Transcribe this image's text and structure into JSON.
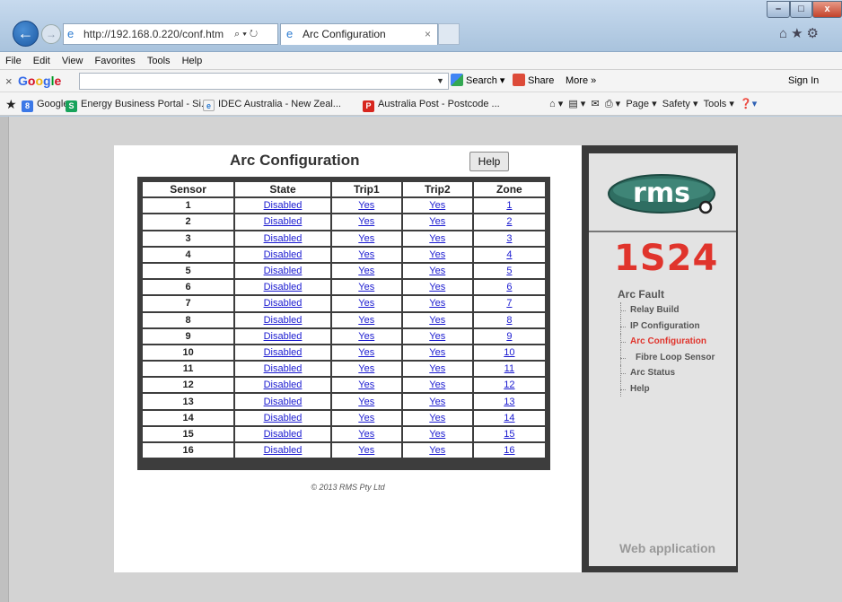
{
  "browser": {
    "window_controls": {
      "minimize": "–",
      "maximize": "□",
      "close": "x"
    },
    "address": "http://192.168.0.220/conf.htm",
    "address_host_bold": "192.168.0.220",
    "tab_title": "Arc Configuration",
    "menu": [
      "File",
      "Edit",
      "View",
      "Favorites",
      "Tools",
      "Help"
    ],
    "google_toolbar": {
      "logo": "Google",
      "search_label": "Search",
      "share_label": "Share",
      "more_label": "More »",
      "signin_label": "Sign In"
    },
    "favorites": [
      {
        "label": "Google",
        "icon": "google-bookmark-icon"
      },
      {
        "label": "Energy Business Portal - Si...",
        "icon": "energy-portal-icon"
      },
      {
        "label": "IDEC Australia - New Zeal...",
        "icon": "ie-page-icon"
      },
      {
        "label": "Australia Post - Postcode ...",
        "icon": "auspost-icon"
      }
    ],
    "command_bar": {
      "page": "Page ▾",
      "safety": "Safety ▾",
      "tools": "Tools ▾"
    }
  },
  "page": {
    "heading": "Arc Configuration",
    "help_button": "Help",
    "table": {
      "headers": [
        "Sensor",
        "State",
        "Trip1",
        "Trip2",
        "Zone"
      ],
      "rows": [
        [
          "1",
          "Disabled",
          "Yes",
          "Yes",
          "1"
        ],
        [
          "2",
          "Disabled",
          "Yes",
          "Yes",
          "2"
        ],
        [
          "3",
          "Disabled",
          "Yes",
          "Yes",
          "3"
        ],
        [
          "4",
          "Disabled",
          "Yes",
          "Yes",
          "4"
        ],
        [
          "5",
          "Disabled",
          "Yes",
          "Yes",
          "5"
        ],
        [
          "6",
          "Disabled",
          "Yes",
          "Yes",
          "6"
        ],
        [
          "7",
          "Disabled",
          "Yes",
          "Yes",
          "7"
        ],
        [
          "8",
          "Disabled",
          "Yes",
          "Yes",
          "8"
        ],
        [
          "9",
          "Disabled",
          "Yes",
          "Yes",
          "9"
        ],
        [
          "10",
          "Disabled",
          "Yes",
          "Yes",
          "10"
        ],
        [
          "11",
          "Disabled",
          "Yes",
          "Yes",
          "11"
        ],
        [
          "12",
          "Disabled",
          "Yes",
          "Yes",
          "12"
        ],
        [
          "13",
          "Disabled",
          "Yes",
          "Yes",
          "13"
        ],
        [
          "14",
          "Disabled",
          "Yes",
          "Yes",
          "14"
        ],
        [
          "15",
          "Disabled",
          "Yes",
          "Yes",
          "15"
        ],
        [
          "16",
          "Disabled",
          "Yes",
          "Yes",
          "16"
        ]
      ]
    },
    "copyright": "© 2013 RMS Pty Ltd"
  },
  "sidebar": {
    "logo_text": "rms",
    "model": "1S24",
    "section_title": "Arc Fault",
    "items": [
      {
        "label": "Relay Build",
        "active": false,
        "indent": false
      },
      {
        "label": "IP Configuration",
        "active": false,
        "indent": false
      },
      {
        "label": "Arc Configuration",
        "active": true,
        "indent": false
      },
      {
        "label": "Fibre Loop Sensor",
        "active": false,
        "indent": true
      },
      {
        "label": "Arc Status",
        "active": false,
        "indent": false
      },
      {
        "label": "Help",
        "active": false,
        "indent": false
      }
    ],
    "footer": "Web application"
  },
  "colors": {
    "accent_red": "#e0342c",
    "link_blue": "#1a1ad0",
    "panel_dark": "#3a3a3a"
  }
}
